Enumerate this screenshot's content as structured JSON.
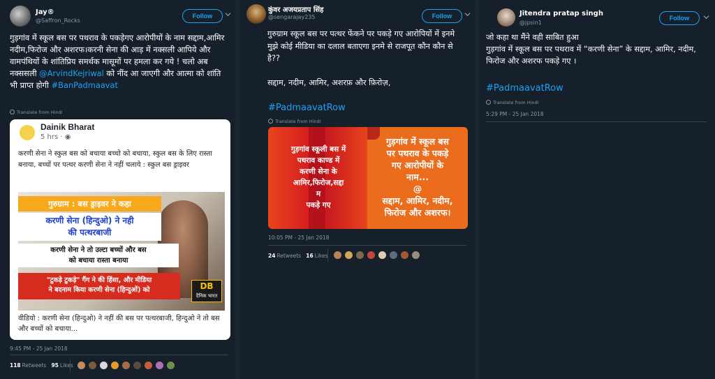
{
  "tweets": [
    {
      "name": "Jay®",
      "handle": "@Saffron_Rocks",
      "follow_label": "Follow",
      "body": "गुड़गांव में स्कूल बस पर पथराव के पकड़ेगए आरोपीयों के नाम सद्दाम,आमिर नदीम,फिरोज और अशरफ।करनी सेना की आड़ में नक्सली आपिये और वामपंथियों के शांतिप्रिय समर्थक मासूमों पर हमला कर गये ! चलो अब नक्ससली",
      "mention": "@ArvindKejriwal",
      "body_tail": " को नींद आ जाएगी और आत्मा को शांति भी प्राप्त होगी ",
      "hashtag": "#BanPadmaavat",
      "translate": "Translate from Hindi",
      "embed": {
        "page_name": "Dainik Bharat",
        "time": "5 hrs · ",
        "post_text": "करणी सेना ने स्कुल बस को बचाया बच्चो को बचाया, स्कुल बस के लिए रास्ता बनाया, बच्चों पर पत्थर करणी सेना ने नहीं चलाये : स्कुल बस ड्राइवर",
        "caption_1": "गुरुग्राम : बस ड्राइवर ने कहा",
        "caption_2": "करणी सेना (हिन्दुओ) ने नही\nकी पत्थरबाजी",
        "caption_3": "करणी सेना ने तो उल्टा बच्चों और बस\nको बचाया रास्ता बनाया",
        "caption_4": "\"टुकड़े टुकड़े\" गैंग ने की हिंसा, और मीडिया\nने बदनाम किया करणी सेना (हिन्दुओं) को",
        "logo_text": "DB",
        "logo_sub": "दैनिक भारत",
        "bottom_text": "वीडियो : करणी सेना (हिन्दुओ) ने नहीं की बस पर पत्थरबाजी, हिन्दुओ ने तो बस और बच्चों को बचाया..."
      },
      "timestamp": "9:45 PM - 25 Jan 2018",
      "retweets": "118",
      "retweets_label": "Retweets",
      "likes": "95",
      "likes_label": "Likes"
    },
    {
      "name": "कुंवर अजयप्रताप सिंह",
      "handle": "@sengarajay235",
      "follow_label": "Follow",
      "body": "गुरुग्राम स्कूल बस पर पत्थर फेंकने पर पकड़े गए आरोपियों में इनमे मुझे कोई मीडिया का दलाल बताएगा इनमे से राजपूत कौन कौन से है??\n\nसद्दाम, नदीम, आमिर, अशरफ़ और फ़िरोज़,",
      "hashtag": "#PadmaavatRow",
      "translate": "Translate from Hindi",
      "panel_left": "गुड़गांव स्कूली बस में\nपथराव काण्ड में\nकरणी सेना के\nआमिर,फिरोज,सद्दा\nम\nपकड़े गए",
      "panel_right": "गुड़गांव में स्कूल बस\nपर पथराव के पकड़े\nगए आरोपीयों के\nनाम...\n@\nसद्दाम, आमिर, नदीम,\nफिरोज और अशरफ।",
      "timestamp": "10:05 PM - 25 Jan 2018",
      "retweets": "24",
      "retweets_label": "Retweets",
      "likes": "16",
      "likes_label": "Likes"
    },
    {
      "name": "Jitendra pratap singh",
      "handle": "@jpsin1",
      "follow_label": "Follow",
      "body": "जो कहा था मैंने वही साबित हुआ\nगुड़गांव में स्कूल बस पर पथराव में “करणी सेना”  के सद्दाम, आमिर, नदीम, फिरोज और अशरफ पकड़े गए ।",
      "hashtag": "#PadmaavatRow",
      "translate": "Translate from Hindi",
      "timestamp": "5:29 PM - 25 Jan 2018"
    }
  ],
  "colors": {
    "accent": "#1da1f2",
    "background": "#15202b",
    "muted": "#8899a6"
  }
}
